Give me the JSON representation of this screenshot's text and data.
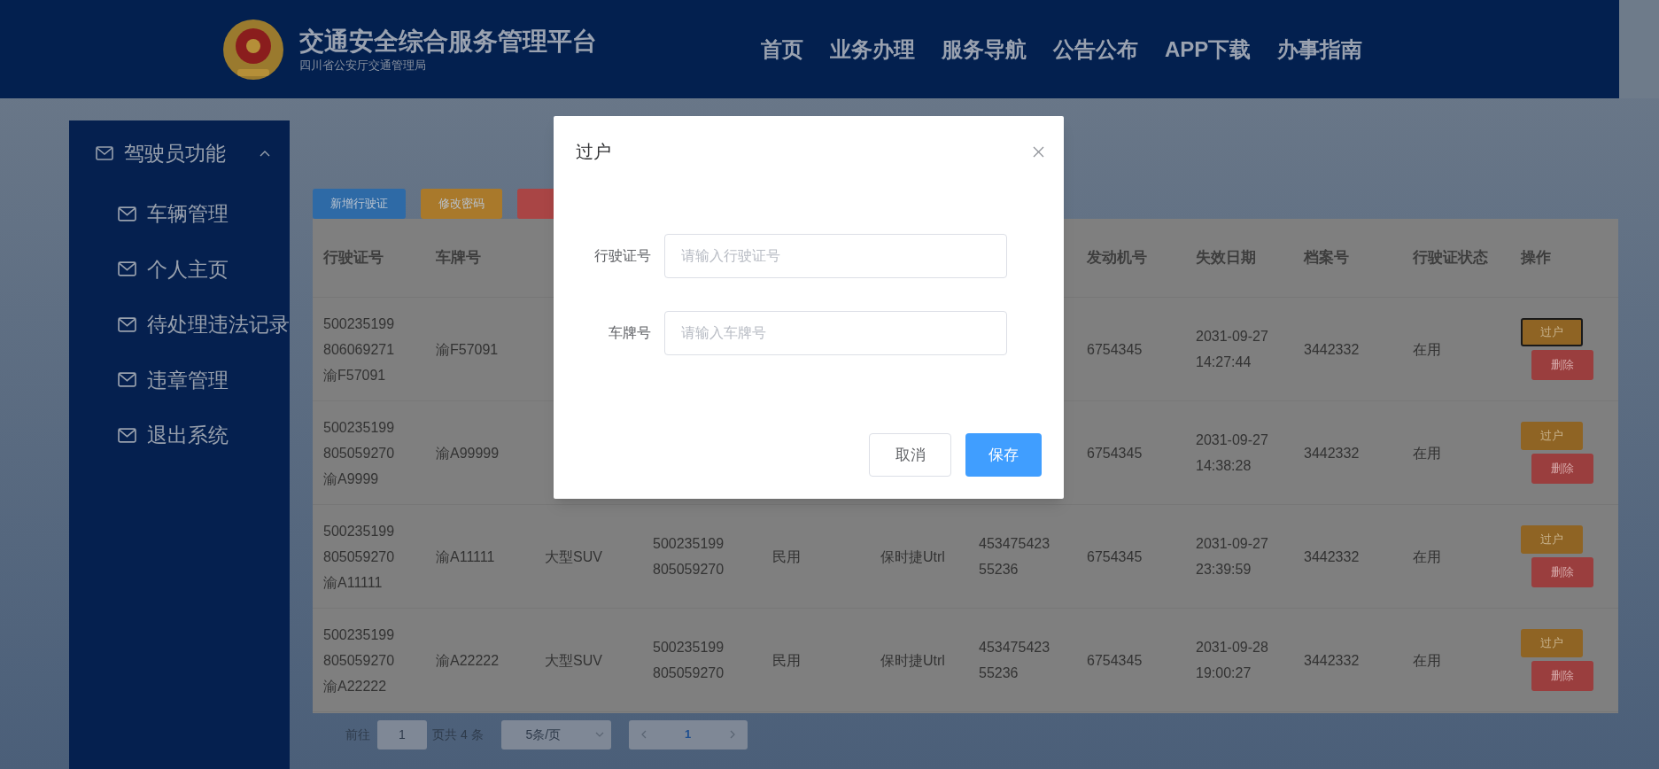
{
  "header": {
    "title": "交通安全综合服务管理平台",
    "subtitle": "四川省公安厅交通管理局",
    "nav": [
      {
        "label": "首页"
      },
      {
        "label": "业务办理"
      },
      {
        "label": "服务导航"
      },
      {
        "label": "公告公布"
      },
      {
        "label": "APP下载"
      },
      {
        "label": "办事指南"
      }
    ]
  },
  "sidebar": {
    "group": {
      "label": "驾驶员功能",
      "expanded": true
    },
    "items": [
      {
        "label": "车辆管理"
      },
      {
        "label": "个人主页"
      },
      {
        "label": "待处理违法记录"
      },
      {
        "label": "违章管理"
      },
      {
        "label": "退出系统"
      }
    ]
  },
  "toolbar": {
    "buttons": [
      {
        "label": "新增行驶证",
        "kind": "primary"
      },
      {
        "label": "修改密码",
        "kind": "warning"
      },
      {
        "kind": "danger"
      }
    ]
  },
  "table": {
    "columns": [
      {
        "label": "行驶证号"
      },
      {
        "label": "车牌号"
      },
      {},
      {},
      {},
      {},
      {},
      {
        "label": "发动机号"
      },
      {
        "label": "失效日期"
      },
      {
        "label": "档案号"
      },
      {
        "label": "行驶证状态"
      },
      {
        "label": "操作"
      }
    ],
    "rows": [
      {
        "cells": [
          "500235199806069271渝F57091",
          "渝F57091",
          null,
          null,
          null,
          null,
          null,
          "6754345",
          "2031-09-27 14:27:44",
          "3442332",
          "在用"
        ],
        "transfer": {
          "label": "过户",
          "focused": true
        },
        "delete": {
          "label": "删除"
        }
      },
      {
        "cells": [
          "500235199805059270渝A9999",
          "渝A99999",
          null,
          null,
          null,
          null,
          null,
          "6754345",
          "2031-09-27 14:38:28",
          "3442332",
          "在用"
        ],
        "transfer": {
          "label": "过户",
          "focused": false
        },
        "delete": {
          "label": "删除"
        }
      },
      {
        "cells": [
          "500235199805059270渝A11111",
          "渝A11111",
          "大型SUV",
          "500235199805059270",
          "民用",
          "保时捷Utrl",
          "45347542355236",
          "6754345",
          "2031-09-27 23:39:59",
          "3442332",
          "在用"
        ],
        "transfer": {
          "label": "过户",
          "focused": false
        },
        "delete": {
          "label": "删除"
        }
      },
      {
        "cells": [
          "500235199805059270渝A22222",
          "渝A22222",
          "大型SUV",
          "500235199805059270",
          "民用",
          "保时捷Utrl",
          "45347542355236",
          "6754345",
          "2031-09-28 19:00:27",
          "3442332",
          "在用"
        ],
        "transfer": {
          "label": "过户",
          "focused": false
        },
        "delete": {
          "label": "删除"
        }
      }
    ]
  },
  "pagination": {
    "goto_label": "前往",
    "page_input": "1",
    "total": "页共 4 条",
    "page_size": "5条/页",
    "pages": [
      {
        "label": "1",
        "selected": true
      }
    ]
  },
  "dialog": {
    "title": "过户",
    "fields": [
      {
        "label": "行驶证号",
        "placeholder": "请输入行驶证号"
      },
      {
        "label": "车牌号",
        "placeholder": "请输入车牌号"
      }
    ],
    "buttons": [
      {
        "label": "取消",
        "kind": "default"
      },
      {
        "label": "保存",
        "kind": "primary"
      }
    ]
  }
}
